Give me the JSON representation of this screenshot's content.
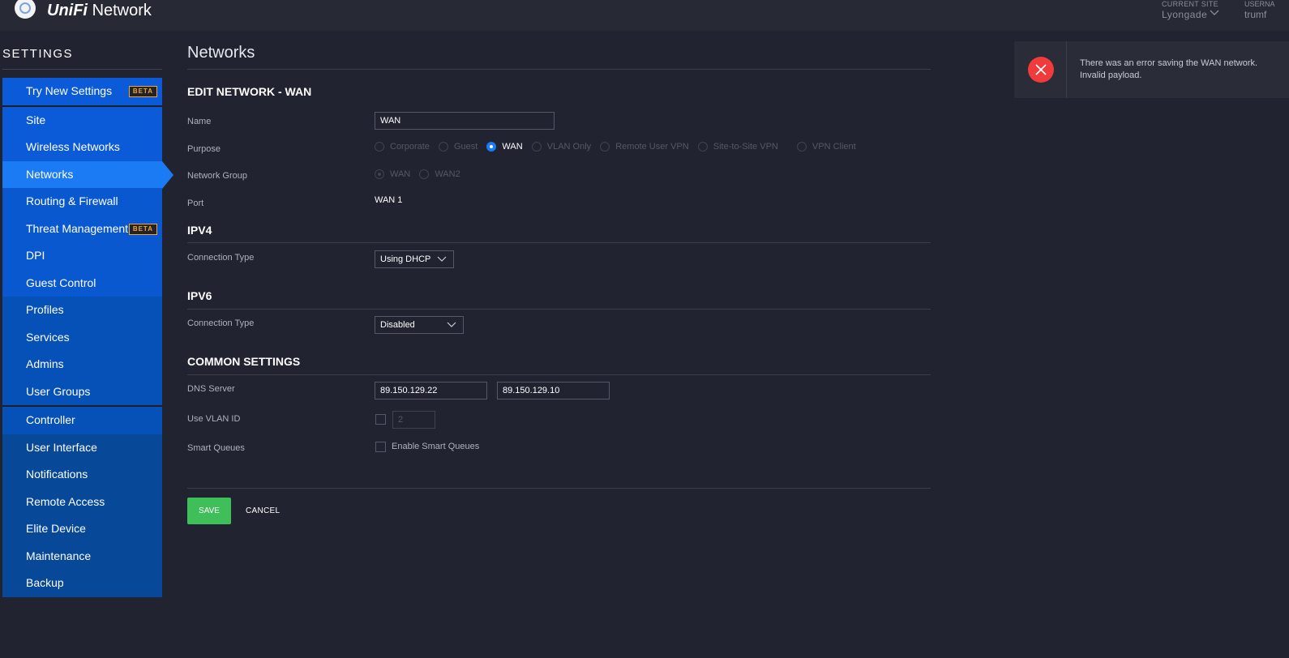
{
  "header": {
    "brand_bold": "UniFi",
    "brand_rest": "Network",
    "site_label": "CURRENT SITE",
    "site_value": "Lyongade",
    "user_label": "USERNA",
    "user_value": "trumf"
  },
  "sidebar": {
    "title": "SETTINGS",
    "items": [
      {
        "label": "Try New Settings",
        "badge": "BETA"
      },
      {
        "label": "Site"
      },
      {
        "label": "Wireless Networks"
      },
      {
        "label": "Networks"
      },
      {
        "label": "Routing & Firewall"
      },
      {
        "label": "Threat Management",
        "badge": "BETA"
      },
      {
        "label": "DPI"
      },
      {
        "label": "Guest Control"
      },
      {
        "label": "Profiles"
      },
      {
        "label": "Services"
      },
      {
        "label": "Admins"
      },
      {
        "label": "User Groups"
      },
      {
        "label": "Controller"
      },
      {
        "label": "User Interface"
      },
      {
        "label": "Notifications"
      },
      {
        "label": "Remote Access"
      },
      {
        "label": "Elite Device"
      },
      {
        "label": "Maintenance"
      },
      {
        "label": "Backup"
      }
    ]
  },
  "main": {
    "page_title": "Networks",
    "edit_title": "EDIT NETWORK - WAN",
    "name_label": "Name",
    "name_value": "WAN",
    "purpose_label": "Purpose",
    "purpose_options": [
      "Corporate",
      "Guest",
      "WAN",
      "VLAN Only",
      "Remote User VPN",
      "Site-to-Site VPN",
      "VPN Client"
    ],
    "purpose_selected": "WAN",
    "network_group_label": "Network Group",
    "network_group_options": [
      "WAN",
      "WAN2"
    ],
    "port_label": "Port",
    "port_value": "WAN 1",
    "ipv4_title": "IPV4",
    "ipv4_conn_label": "Connection Type",
    "ipv4_conn_value": "Using DHCP",
    "ipv6_title": "IPV6",
    "ipv6_conn_label": "Connection Type",
    "ipv6_conn_value": "Disabled",
    "common_title": "COMMON SETTINGS",
    "dns_label": "DNS Server",
    "dns1": "89.150.129.22",
    "dns2": "89.150.129.10",
    "vlan_label": "Use VLAN ID",
    "vlan_value": "2",
    "smart_label": "Smart Queues",
    "smart_check_label": "Enable Smart Queues",
    "save_label": "SAVE",
    "cancel_label": "CANCEL"
  },
  "toast": {
    "line1": "There was an error saving the WAN network.",
    "line2": "Invalid payload."
  },
  "colors": {
    "accent": "#1a7bf5",
    "save": "#3fbf5a",
    "error": "#ef3b3b",
    "badge": "#f5a623"
  }
}
